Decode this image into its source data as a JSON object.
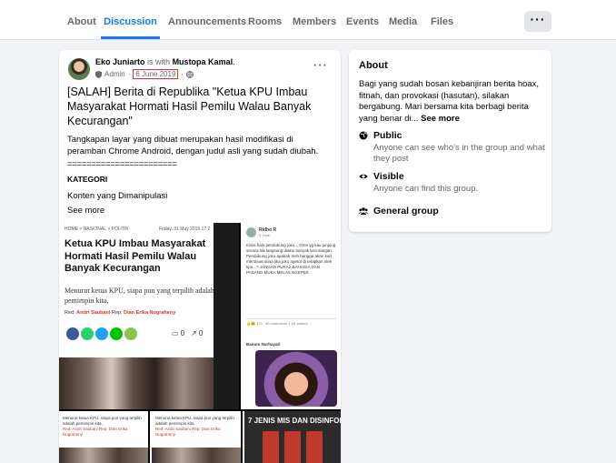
{
  "tabs": [
    {
      "label": "About"
    },
    {
      "label": "Discussion"
    },
    {
      "label": "Announcements"
    },
    {
      "label": "Rooms"
    },
    {
      "label": "Members"
    },
    {
      "label": "Events"
    },
    {
      "label": "Media"
    },
    {
      "label": "Files"
    }
  ],
  "post": {
    "author": "Eko Juniarto",
    "with_text": "is with",
    "tagged": "Mustopa Kamal",
    "role": "Admin",
    "date": "6 June 2019",
    "title": "[SALAH] Berita di Republika \"Ketua KPU Imbau Masyarakat Hormati Hasil Pemilu Walau Banyak Kecurangan\"",
    "description": "Tangkapan layar yang dibuat merupakan hasil modifikasi di peramban Chrome Android, dengan judul asli yang sudah diubah.",
    "separator": "=======================",
    "category_label": "KATEGORI",
    "category_value": "Konten yang Dimanipulasi",
    "see_more": "See more"
  },
  "news": {
    "breadcrumb": "HOME > NASIONAL > POLITIK",
    "date": "Friday, 31 May 2019 17:2",
    "headline": "Ketua KPU Imbau Masyarakat Hormati Hasil Pemilu Walau Banyak Kecurangan",
    "lead": "Menurut ketua KPU, siapa pun yang terpilih adalah pemimpin kita,",
    "credit_prefix": "Red:",
    "red": "Andri Saubani",
    "rep_prefix": "Rep:",
    "rep": "Dian Erika Nugraheny",
    "share_count": "0",
    "comment_count": "0"
  },
  "fbpost": {
    "name": "Ridho R",
    "sub": "5 June",
    "text": "Kisisi halo pendukung joko,,, Gmn yg kau junjung secara tak langsung diakui banyak kecurangan, Pendukung joko apakah msh bangga akan kurl membuat dosa jika joko ngetor di tetapkan oleh kpu...? JANGAN PURA2 BAHAGIA DAN PASANG MUKA MELAS NGEPEK",
    "reacts": "175",
    "comments": "85 comments  1.1K shares",
    "commenter": "Banum Nurhayati"
  },
  "bottom": {
    "mini_text": "Menurut ketua KPU, siapa pun yang terpilih adalah pemimpin kita,",
    "mini_credit": "Red: Andri Saubani Rep: Dian Erika Nugraheny",
    "banner": "7 JENIS MIS DAN DISINFORMASI"
  },
  "about": {
    "title": "About",
    "description": "Bagi yang sudah bosan kebanjiran berita hoax, fitnah, dan provokasi (hasutan), silakan bergabung. Mari bersama kita berbagi berita yang benar di...",
    "see_more": "See more",
    "public_title": "Public",
    "public_sub": "Anyone can see who's in the group and what they post",
    "visible_title": "Visible",
    "visible_sub": "Anyone can find this group.",
    "general": "General group"
  },
  "colors": {
    "accent": "#1877f2",
    "highlight": "#e0322a"
  }
}
